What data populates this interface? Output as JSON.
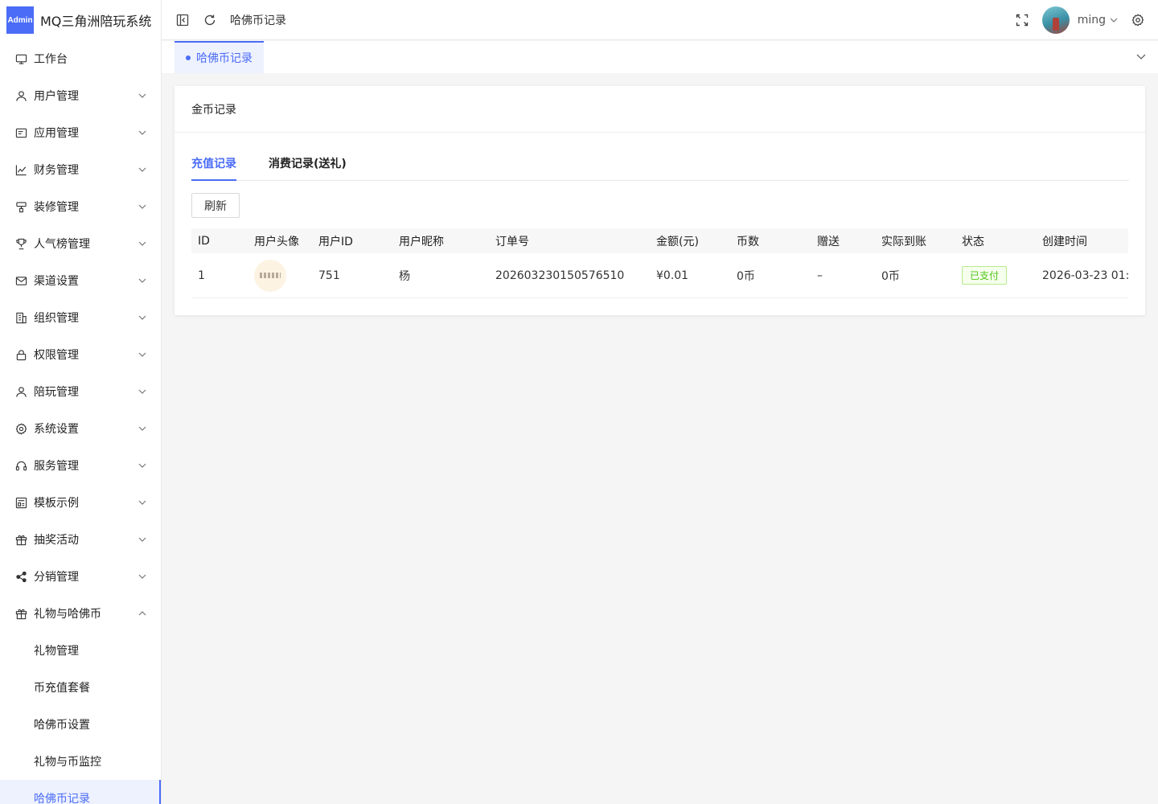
{
  "app": {
    "logo_badge": "Admin",
    "title": "MQ三角洲陪玩系统"
  },
  "sidebar": {
    "items": [
      {
        "label": "工作台",
        "icon": "monitor-icon",
        "expandable": false
      },
      {
        "label": "用户管理",
        "icon": "user-icon",
        "expandable": true
      },
      {
        "label": "应用管理",
        "icon": "app-icon",
        "expandable": true
      },
      {
        "label": "财务管理",
        "icon": "chart-icon",
        "expandable": true
      },
      {
        "label": "装修管理",
        "icon": "decoration-icon",
        "expandable": true
      },
      {
        "label": "人气榜管理",
        "icon": "trophy-icon",
        "expandable": true
      },
      {
        "label": "渠道设置",
        "icon": "mail-icon",
        "expandable": true
      },
      {
        "label": "组织管理",
        "icon": "building-icon",
        "expandable": true
      },
      {
        "label": "权限管理",
        "icon": "lock-icon",
        "expandable": true
      },
      {
        "label": "陪玩管理",
        "icon": "user-icon",
        "expandable": true
      },
      {
        "label": "系统设置",
        "icon": "gear-icon",
        "expandable": true
      },
      {
        "label": "服务管理",
        "icon": "headset-icon",
        "expandable": true
      },
      {
        "label": "模板示例",
        "icon": "template-icon",
        "expandable": true
      },
      {
        "label": "抽奖活动",
        "icon": "gift-icon",
        "expandable": true
      },
      {
        "label": "分销管理",
        "icon": "share-icon",
        "expandable": true
      },
      {
        "label": "礼物与哈佛币",
        "icon": "gift-icon",
        "expandable": true,
        "expanded": true
      }
    ],
    "sub_items": [
      {
        "label": "礼物管理"
      },
      {
        "label": "币充值套餐"
      },
      {
        "label": "哈佛币设置"
      },
      {
        "label": "礼物与币监控"
      },
      {
        "label": "哈佛币记录",
        "active": true
      }
    ]
  },
  "header": {
    "breadcrumb": "哈佛币记录",
    "username": "ming"
  },
  "tabs": {
    "active_label": "哈佛币记录"
  },
  "card": {
    "title": "金币记录",
    "subtabs": [
      "充值记录",
      "消费记录(送礼)"
    ],
    "active_subtab": 0,
    "refresh_label": "刷新",
    "columns": [
      "ID",
      "用户头像",
      "用户ID",
      "用户昵称",
      "订单号",
      "金额(元)",
      "币数",
      "赠送",
      "实际到账",
      "状态",
      "创建时间"
    ],
    "rows": [
      {
        "id": "1",
        "user_id": "751",
        "nickname": "杨",
        "order_no": "202603230150576510",
        "amount": "¥0.01",
        "coins": "0币",
        "bonus": "–",
        "received": "0币",
        "status": "已支付",
        "created": "2026-03-23 01:"
      }
    ]
  },
  "colors": {
    "accent": "#4a6cf7",
    "status_paid": "#52c41a"
  }
}
